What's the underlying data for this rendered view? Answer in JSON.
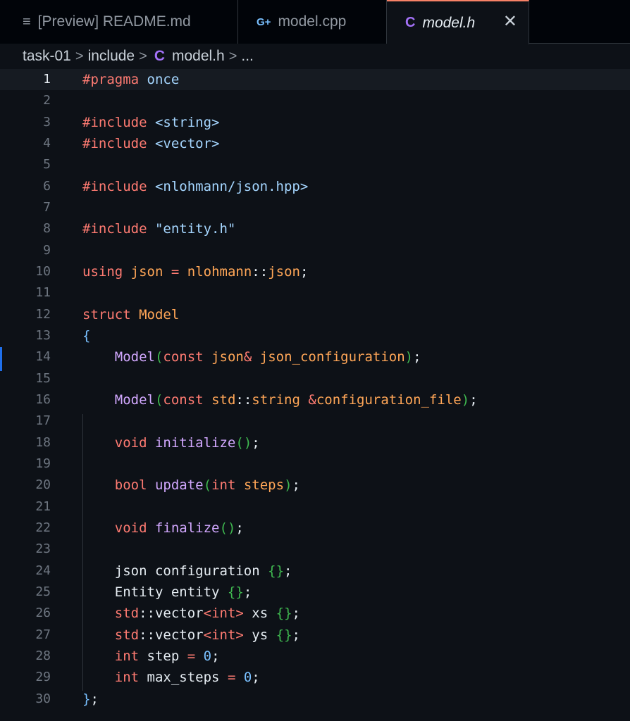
{
  "tabs": [
    {
      "label": "[Preview] README.md",
      "icon": "preview-icon",
      "glyph": "≡"
    },
    {
      "label": "model.cpp",
      "icon": "cpp-file-icon",
      "glyph": "G+"
    },
    {
      "label": "model.h",
      "icon": "c-file-icon",
      "glyph": "C",
      "active": true,
      "close_glyph": "✕"
    }
  ],
  "breadcrumb": {
    "segments": [
      "task-01",
      "include",
      "model.h",
      "..."
    ],
    "separator": ">",
    "file_icon_glyph": "C"
  },
  "editor": {
    "current_line": 1,
    "lines": [
      {
        "n": "1",
        "text": "#pragma once"
      },
      {
        "n": "2",
        "text": ""
      },
      {
        "n": "3",
        "text": "#include <string>"
      },
      {
        "n": "4",
        "text": "#include <vector>"
      },
      {
        "n": "5",
        "text": ""
      },
      {
        "n": "6",
        "text": "#include <nlohmann/json.hpp>"
      },
      {
        "n": "7",
        "text": ""
      },
      {
        "n": "8",
        "text": "#include \"entity.h\""
      },
      {
        "n": "9",
        "text": ""
      },
      {
        "n": "10",
        "text": "using json = nlohmann::json;"
      },
      {
        "n": "11",
        "text": ""
      },
      {
        "n": "12",
        "text": "struct Model"
      },
      {
        "n": "13",
        "text": "{"
      },
      {
        "n": "14",
        "text": "    Model(const json& json_configuration);"
      },
      {
        "n": "15",
        "text": ""
      },
      {
        "n": "16",
        "text": "    Model(const std::string &configuration_file);"
      },
      {
        "n": "17",
        "text": ""
      },
      {
        "n": "18",
        "text": "    void initialize();"
      },
      {
        "n": "19",
        "text": ""
      },
      {
        "n": "20",
        "text": "    bool update(int steps);"
      },
      {
        "n": "21",
        "text": ""
      },
      {
        "n": "22",
        "text": "    void finalize();"
      },
      {
        "n": "23",
        "text": ""
      },
      {
        "n": "24",
        "text": "    json configuration {};"
      },
      {
        "n": "25",
        "text": "    Entity entity {};"
      },
      {
        "n": "26",
        "text": "    std::vector<int> xs {};"
      },
      {
        "n": "27",
        "text": "    std::vector<int> ys {};"
      },
      {
        "n": "28",
        "text": "    int step = 0;"
      },
      {
        "n": "29",
        "text": "    int max_steps = 0;"
      },
      {
        "n": "30",
        "text": "};"
      }
    ]
  },
  "colors": {
    "background": "#0d1117",
    "keyword": "#ff7b72",
    "string": "#a5d6ff",
    "type": "#ffa657",
    "function": "#d2a8ff",
    "number": "#79c0ff",
    "active_tab_accent": "#f78166"
  }
}
